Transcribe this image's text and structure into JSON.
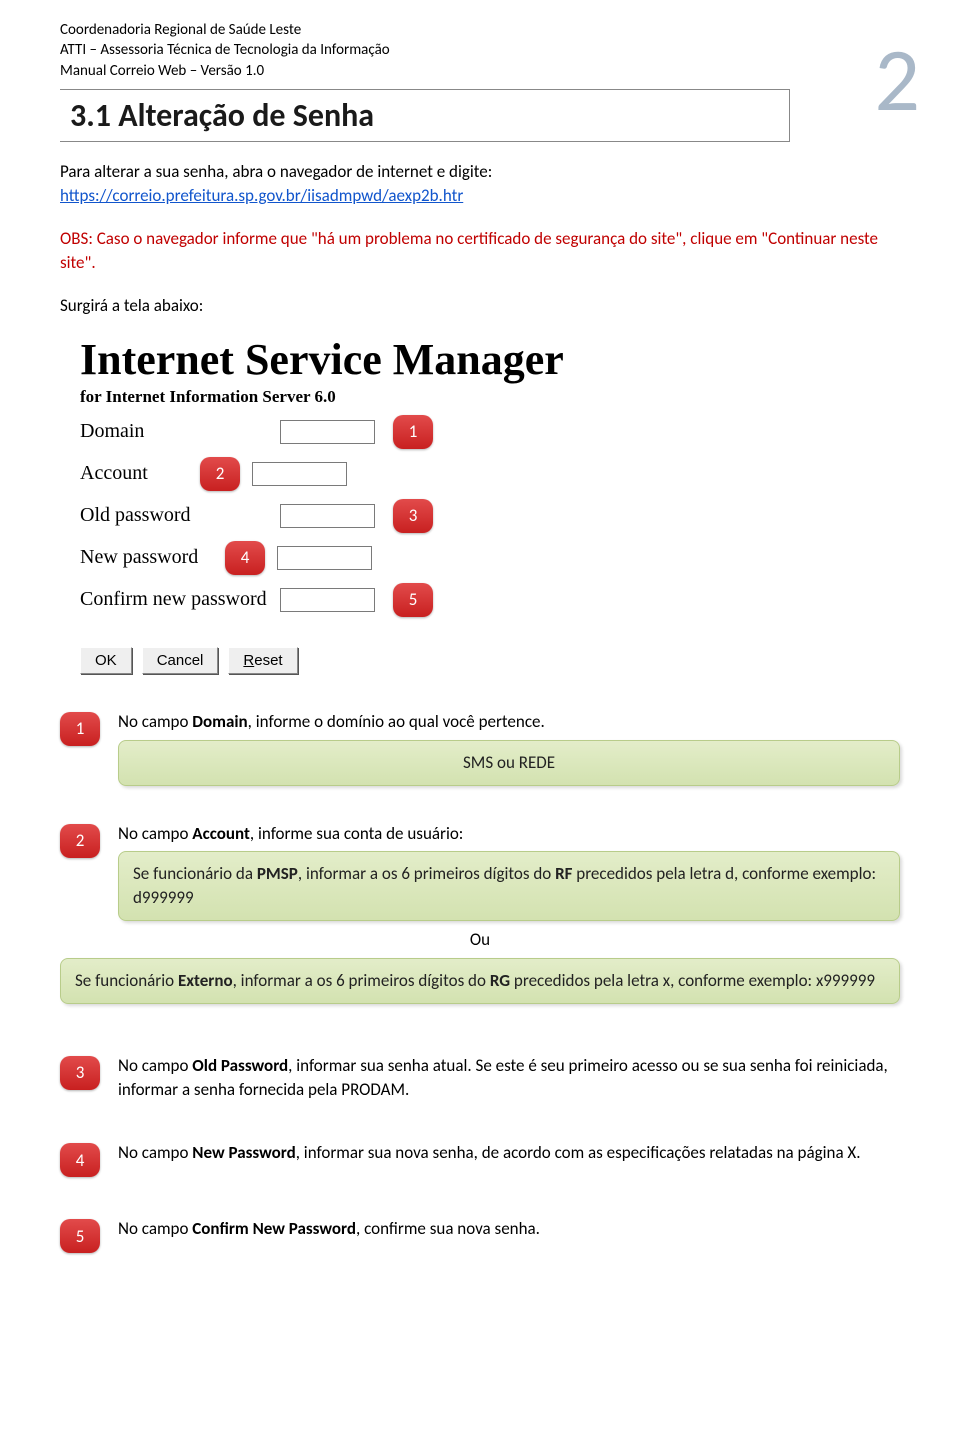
{
  "header": {
    "line1": "Coordenadoria Regional de Saúde Leste",
    "line2": "ATTI – Assessoria Técnica de Tecnologia da Informação",
    "line3": "Manual Correio Web – Versão 1.0"
  },
  "page_number": "2",
  "section_title": "3.1 Alteração de Senha",
  "intro_text": "Para alterar a sua senha, abra o navegador de internet e digite:",
  "intro_url": "https://correio.prefeitura.sp.gov.br/iisadmpwd/aexp2b.htr",
  "obs": "OBS: Caso o navegador informe que \"há um problema no certificado de segurança do site\", clique em \"Continuar neste site\".",
  "surgira": "Surgirá a tela abaixo:",
  "ism": {
    "title": "Internet Service Manager",
    "sub": "for Internet Information Server 6.0",
    "fields": {
      "domain": "Domain",
      "account": "Account",
      "old_password": "Old password",
      "new_password": "New password",
      "confirm": "Confirm new password"
    },
    "buttons": {
      "ok": "OK",
      "cancel": "Cancel",
      "reset_u": "R",
      "reset_rest": "eset"
    }
  },
  "badges": {
    "b1": "1",
    "b2": "2",
    "b3": "3",
    "b4": "4",
    "b5": "5"
  },
  "step1": {
    "text_before": "No campo ",
    "bold": "Domain",
    "text_after": ", informe o domínio ao qual você pertence.",
    "green": "SMS ou REDE"
  },
  "step2": {
    "text_before": "No campo ",
    "bold": "Account",
    "text_after": ", informe sua conta de usuário:",
    "green1_a": "Se funcionário da ",
    "green1_b": "PMSP",
    "green1_c": ", informar a os 6 primeiros dígitos do ",
    "green1_d": "RF",
    "green1_e": " precedidos pela letra d, conforme exemplo: d999999",
    "ou": "Ou",
    "green2_a": "Se funcionário ",
    "green2_b": "Externo",
    "green2_c": ", informar a os 6 primeiros dígitos do ",
    "green2_d": "RG",
    "green2_e": " precedidos pela letra x, conforme exemplo: x999999"
  },
  "step3": {
    "text_before": "No campo ",
    "bold": "Old Password",
    "text_after": ", informar sua senha atual. Se este é seu primeiro acesso ou se sua senha foi reiniciada, informar a senha fornecida pela PRODAM."
  },
  "step4": {
    "text_before": "No campo ",
    "bold": "New Password",
    "text_after": ", informar sua nova senha, de acordo com as especificações relatadas na página X."
  },
  "step5": {
    "text_before": "No campo ",
    "bold": "Confirm New Password",
    "text_after": ", confirme sua nova senha."
  }
}
